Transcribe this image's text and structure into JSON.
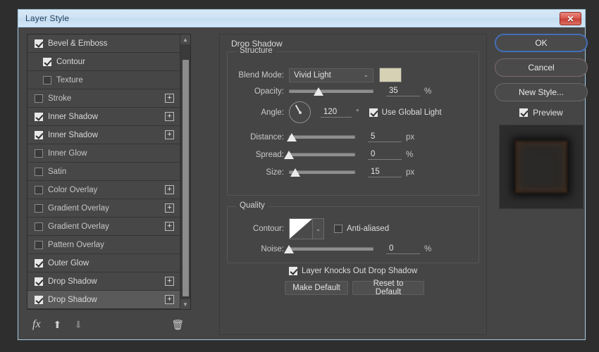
{
  "window": {
    "title": "Layer Style",
    "close_label": "✕"
  },
  "effects_list": {
    "items": [
      {
        "label": "Bevel & Emboss",
        "checked": true,
        "sub": false,
        "plus": false,
        "selected": false
      },
      {
        "label": "Contour",
        "checked": true,
        "sub": true,
        "plus": false,
        "selected": false
      },
      {
        "label": "Texture",
        "checked": false,
        "sub": true,
        "plus": false,
        "selected": false
      },
      {
        "label": "Stroke",
        "checked": false,
        "sub": false,
        "plus": true,
        "selected": false
      },
      {
        "label": "Inner Shadow",
        "checked": true,
        "sub": false,
        "plus": true,
        "selected": false
      },
      {
        "label": "Inner Shadow",
        "checked": true,
        "sub": false,
        "plus": true,
        "selected": false
      },
      {
        "label": "Inner Glow",
        "checked": false,
        "sub": false,
        "plus": false,
        "selected": false
      },
      {
        "label": "Satin",
        "checked": false,
        "sub": false,
        "plus": false,
        "selected": false
      },
      {
        "label": "Color Overlay",
        "checked": false,
        "sub": false,
        "plus": true,
        "selected": false
      },
      {
        "label": "Gradient Overlay",
        "checked": false,
        "sub": false,
        "plus": true,
        "selected": false
      },
      {
        "label": "Gradient Overlay",
        "checked": false,
        "sub": false,
        "plus": true,
        "selected": false
      },
      {
        "label": "Pattern Overlay",
        "checked": false,
        "sub": false,
        "plus": false,
        "selected": false
      },
      {
        "label": "Outer Glow",
        "checked": true,
        "sub": false,
        "plus": false,
        "selected": false
      },
      {
        "label": "Drop Shadow",
        "checked": true,
        "sub": false,
        "plus": true,
        "selected": false
      },
      {
        "label": "Drop Shadow",
        "checked": true,
        "sub": false,
        "plus": true,
        "selected": true
      }
    ],
    "scroll_up_icon": "▲",
    "scroll_down_icon": "▼"
  },
  "fx_toolbar": {
    "fx_icon": "fx",
    "up_icon": "⬆",
    "down_icon": "⬇",
    "trash_icon": "🗑"
  },
  "panel": {
    "title": "Drop Shadow",
    "structure": {
      "legend": "Structure",
      "blend_mode_label": "Blend Mode:",
      "blend_mode_value": "Vivid Light",
      "blend_mode_chevron": "⌄",
      "color_swatch": "#d6d0b4",
      "opacity_label": "Opacity:",
      "opacity_value": "35",
      "opacity_unit": "%",
      "opacity_pct": 35,
      "angle_label": "Angle:",
      "angle_value": "120",
      "angle_unit": "°",
      "global_light_label": "Use Global Light",
      "global_light_checked": true,
      "distance_label": "Distance:",
      "distance_value": "5",
      "distance_unit": "px",
      "distance_pct": 4,
      "spread_label": "Spread:",
      "spread_value": "0",
      "spread_unit": "%",
      "spread_pct": 0,
      "size_label": "Size:",
      "size_value": "15",
      "size_unit": "px",
      "size_pct": 10
    },
    "quality": {
      "legend": "Quality",
      "contour_label": "Contour:",
      "contour_chevron": "⌄",
      "antialiased_label": "Anti-aliased",
      "antialiased_checked": false,
      "noise_label": "Noise:",
      "noise_value": "0",
      "noise_unit": "%",
      "noise_pct": 0
    },
    "footer": {
      "knockout_label": "Layer Knocks Out Drop Shadow",
      "knockout_checked": true,
      "make_default_label": "Make Default",
      "reset_default_label": "Reset to Default"
    }
  },
  "actions": {
    "ok_label": "OK",
    "cancel_label": "Cancel",
    "new_style_label": "New Style...",
    "preview_label": "Preview",
    "preview_checked": true
  }
}
